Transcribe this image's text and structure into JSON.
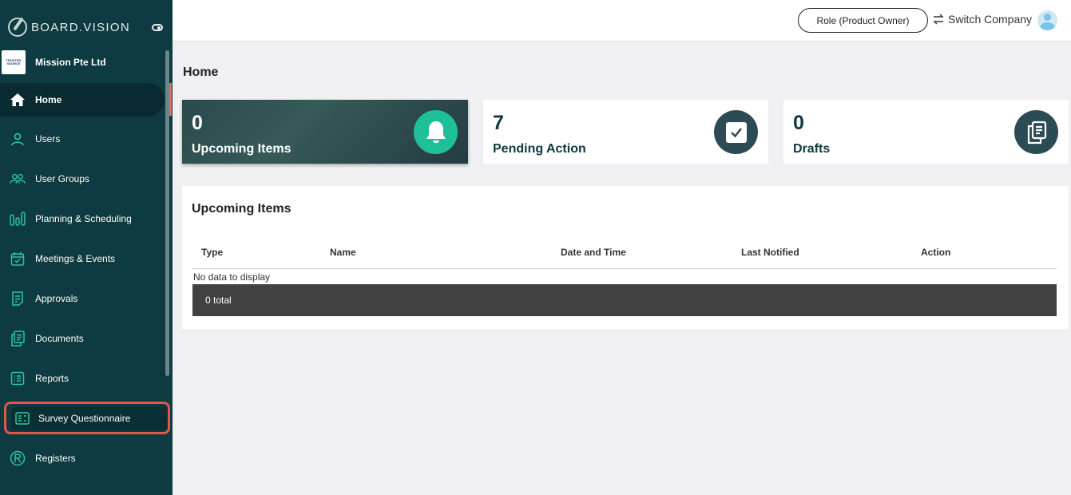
{
  "brand": {
    "name": "BOARD.VISION"
  },
  "company": {
    "name": "Mission Pte Ltd",
    "logo_text": "TRUSTED SOURCE"
  },
  "sidebar": {
    "items": [
      {
        "label": "Home",
        "icon": "home-icon"
      },
      {
        "label": "Users",
        "icon": "user-icon"
      },
      {
        "label": "User Groups",
        "icon": "user-groups-icon"
      },
      {
        "label": "Planning & Scheduling",
        "icon": "planning-icon"
      },
      {
        "label": "Meetings & Events",
        "icon": "calendar-icon"
      },
      {
        "label": "Approvals",
        "icon": "approvals-icon"
      },
      {
        "label": "Documents",
        "icon": "documents-icon"
      },
      {
        "label": "Reports",
        "icon": "reports-icon"
      },
      {
        "label": "Survey Questionnaire",
        "icon": "survey-icon"
      },
      {
        "label": "Registers",
        "icon": "registered-icon"
      }
    ]
  },
  "topbar": {
    "role_label": "Role (Product Owner)",
    "switch_label": "Switch Company"
  },
  "page": {
    "title": "Home"
  },
  "cards": [
    {
      "value": "0",
      "label": "Upcoming Items",
      "icon": "bell-icon",
      "accent": "#1fbf9a"
    },
    {
      "value": "7",
      "label": "Pending Action",
      "icon": "checkbox-icon",
      "accent": "#2d4b54"
    },
    {
      "value": "0",
      "label": "Drafts",
      "icon": "drafts-icon",
      "accent": "#2d4b54"
    }
  ],
  "upcoming": {
    "title": "Upcoming Items",
    "columns": [
      "Type",
      "Name",
      "Date and Time",
      "Last Notified",
      "Action"
    ],
    "empty_text": "No data to display",
    "footer": "0 total"
  }
}
